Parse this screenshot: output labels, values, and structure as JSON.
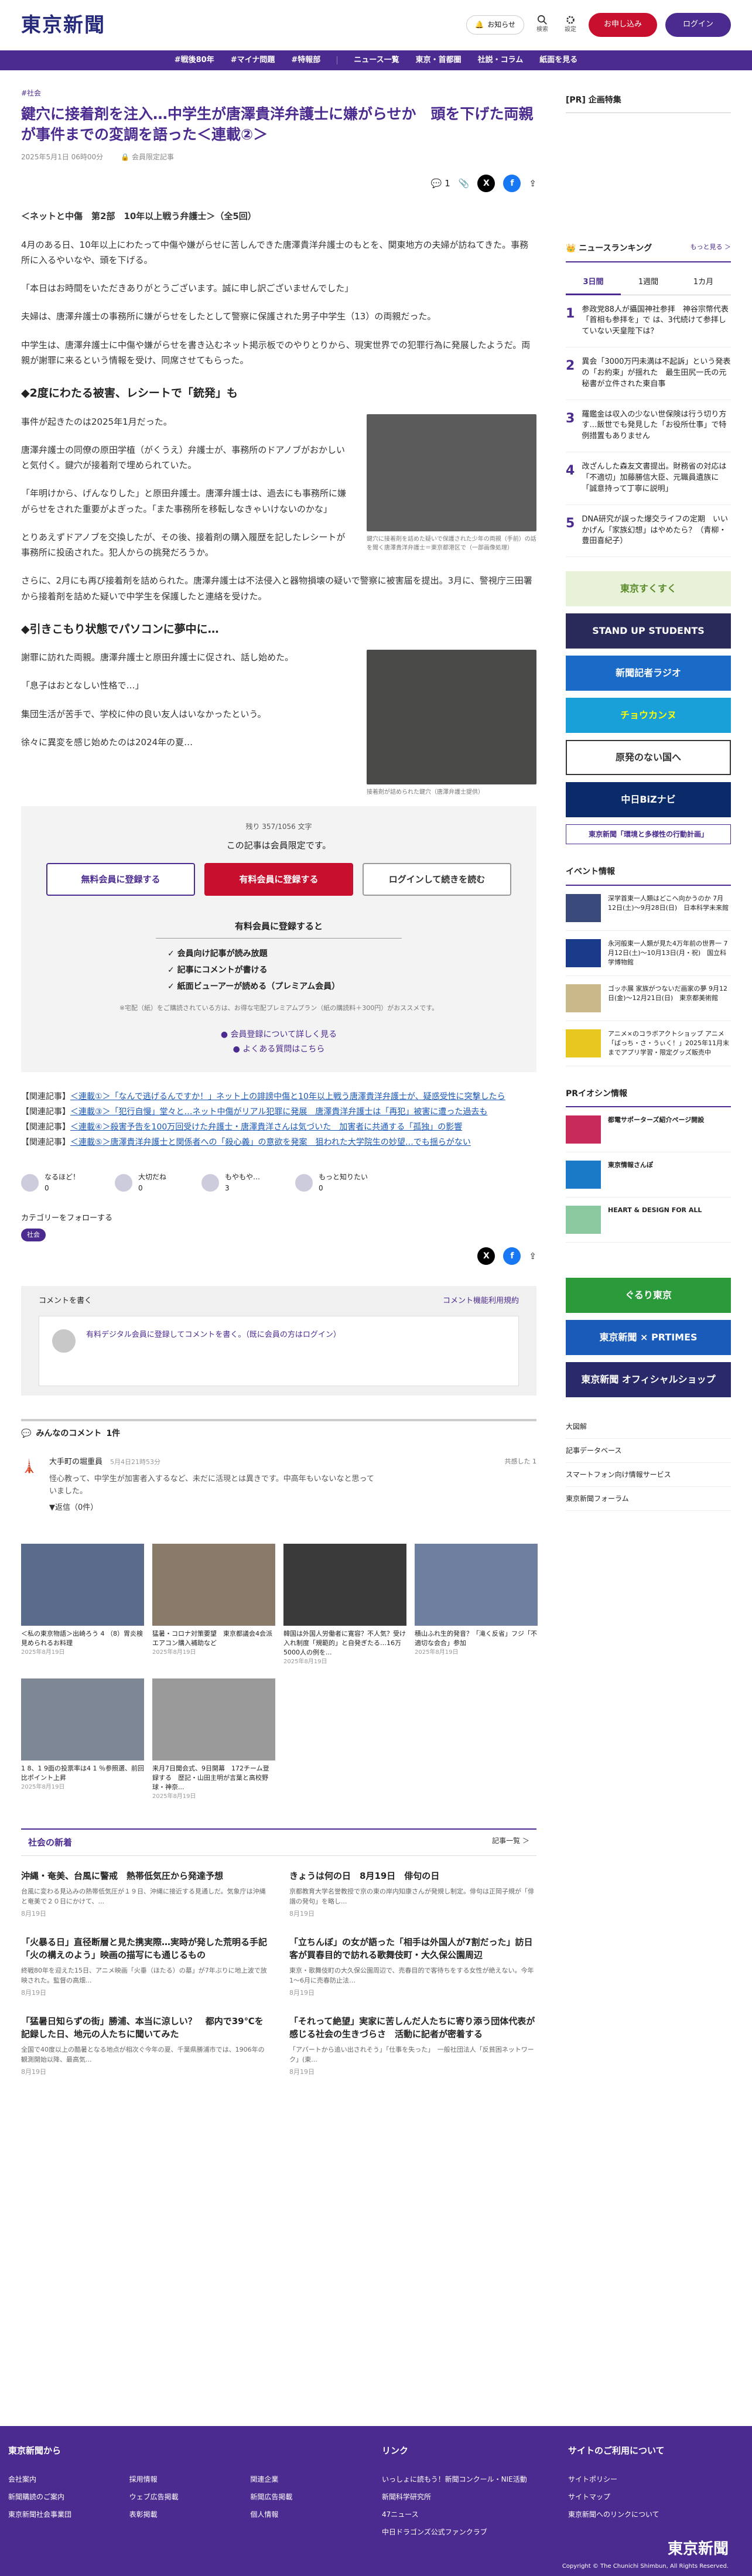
{
  "header": {
    "logo": "東京新聞",
    "notice": "お知らせ",
    "search": "検索",
    "settings": "設定",
    "register": "お申し込み",
    "login": "ログイン"
  },
  "nav": [
    "#戦後80年",
    "#マイナ問題",
    "#特報部",
    "ニュース一覧",
    "東京・首都圏",
    "社説・コラム",
    "紙面を見る"
  ],
  "article": {
    "category": "#社会",
    "title": "鍵穴に接着剤を注入…中学生が唐澤貴洋弁護士に嫌がらせか　頭を下げた両親が事件までの変調を語った＜連載②＞",
    "date": "2025年5月1日 06時00分",
    "member": "会員限定記事",
    "comment_count": "1",
    "subhead": "＜ネットと中傷　第2部　10年以上戦う弁護士＞（全5回）",
    "p1": "4月のある日、10年以上にわたって中傷や嫌がらせに苦しんできた唐澤貴洋弁護士のもとを、関東地方の夫婦が訪ねてきた。事務所に入るやいなや、頭を下げる。",
    "p2": "「本日はお時間をいただきありがとうございます。誠に申し訳ございませんでした」",
    "p3": "夫婦は、唐澤弁護士の事務所に嫌がらせをしたとして警察に保護された男子中学生（13）の両親だった。",
    "p4": "中学生は、唐澤弁護士に中傷や嫌がらせを書き込むネット掲示板でのやりとりから、現実世界での犯罪行為に発展したようだ。両親が謝罪に来るという情報を受け、同席させてもらった。",
    "h2a": "◆2度にわたる被害、レシートで「銃発」も",
    "p5": "事件が起きたのは2025年1月だった。",
    "p6": "唐澤弁護士の同僚の原田学植（がくうえ）弁護士が、事務所のドアノブがおかしいと気付く。鍵穴が接着剤で埋められていた。",
    "p7": "「年明けから、げんなりした」と原田弁護士。唐澤弁護士は、過去にも事務所に嫌がらせをされた重要がよぎった。「また事務所を移転しなきゃいけないのかな」",
    "p8": "とりあえずドアノブを交換したが、その後、接着剤の購入履歴を記したレシートが事務所に投函された。犯人からの挑発だろうか。",
    "p9": "さらに、2月にも再び接着剤を詰められた。唐澤弁護士は不法侵入と器物損壊の疑いで警察に被害届を提出。3月に、警視庁三田署から接着剤を詰めた疑いで中学生を保護したと連絡を受けた。",
    "h2b": "◆引きこもり状態でパソコンに夢中に…",
    "p10": "謝罪に訪れた両親。唐澤弁護士と原田弁護士に促され、話し始めた。",
    "p11": "「息子はおとなしい性格で…」",
    "p12": "集団生活が苦手で、学校に仲の良い友人はいなかったという。",
    "p13": "徐々に異変を感じ始めたのは2024年の夏…",
    "cap1": "鍵穴に接着剤を詰めた疑いで保護された少年の両親（手前）の話を聞く唐澤貴洋弁護士＝東京都港区で（一部画像処理）",
    "cap2": "接着剤が詰められた鍵穴（唐澤弁護士提供）"
  },
  "paywall": {
    "remaining": "残り 357/1056 文字",
    "message": "この記事は会員限定です。",
    "free_btn": "無料会員に登録する",
    "paid_btn": "有料会員に登録する",
    "login_btn": "ログインして続きを読む",
    "perk_head": "有料会員に登録すると",
    "perks": [
      "✓ 会員向け記事が読み放題",
      "✓ 記事にコメントが書ける",
      "✓ 紙面ビューアーが読める（プレミアム会員）"
    ],
    "note": "※宅配（紙）をご購読されている方は、お得な宅配プレミアムプラン（紙の購読料＋300円）がおススメです。",
    "link1": "● 会員登録について詳しく見る",
    "link2": "● よくある質問はこちら"
  },
  "related": [
    {
      "label": "【関連記事】",
      "text": "＜連載①＞「なんで逃げるんですか！」ネット上の誹謗中傷と10年以上戦う唐澤貴洋弁護士が、疑惑受性に突撃したら"
    },
    {
      "label": "【関連記事】",
      "text": "＜連載③＞「犯行自慢」堂々と…ネット中傷がリアル犯罪に発展　唐澤貴洋弁護士は「再犯」被害に遭った過去も"
    },
    {
      "label": "【関連記事】",
      "text": "＜連載④＞殺害予告を100万回受けた弁護士・唐澤貴洋さんは気づいた　加害者に共通する「孤独」の影響"
    },
    {
      "label": "【関連記事】",
      "text": "＜連載⑤＞唐澤貴洋弁護士と関係者への「殺心義」の意欲を発案　狙われた大学院生の妙望…でも揺らがない"
    }
  ],
  "reactions": [
    {
      "label": "なるほど！",
      "count": "0"
    },
    {
      "label": "大切だね",
      "count": "0"
    },
    {
      "label": "もやもや…",
      "count": "3"
    },
    {
      "label": "もっと知りたい",
      "count": "0"
    }
  ],
  "follow": {
    "title": "カテゴリーをフォローする",
    "tag": "社会"
  },
  "comment_box": {
    "title": "コメントを書く",
    "rule": "コメント機能利用規約",
    "prompt": "有料デジタル会員に登録してコメントを書く。（既に会員の方はログイン）"
  },
  "comments": {
    "title": "みんなのコメント",
    "count": "1件",
    "user": "大手町の堀重員",
    "time": "5月4日21時53分",
    "body": "怪心教って、中学生が加害者入するなど、未だに活現とは異きです。中高年もいないなと思っていました。",
    "reply": "▼返信（0件）",
    "likes": "共感した 1"
  },
  "cards": [
    {
      "t": "＜私の東京物語＞出崎ろう 4 （8）胃炎検見められるお料理",
      "d": "2025年8月19日"
    },
    {
      "t": "猛暑・コロナ対策要望　東京都議会4会派　エアコン購入補助など",
      "d": "2025年8月19日"
    },
    {
      "t": "韓国は外国人労働者に寛容？不人気？受け入れ制度「規範的」と自発ぎたる…16万5000人の例を...",
      "d": "2025年8月19日"
    },
    {
      "t": "積山ふれ生的発音？「滝く反省」フジ「不適切な会合」参加",
      "d": "2025年8月19日"
    },
    {
      "t": "1 8、1 9面の投票率は4 1 ％参照選、前回比ポイント上昇",
      "d": "2025年8月19日"
    },
    {
      "t": "来月7日聞会式、9日開幕　172チーム登録する　歴記・山田主明が言葉と高校野球・神奈...",
      "d": "2025年8月19日"
    }
  ],
  "section": {
    "title": "社会の新着",
    "more": "記事一覧 ＞",
    "items": [
      {
        "t": "沖縄・奄美、台風に警戒　熱帯低気圧から発達予想",
        "b": "台風に変わる見込みの熱帯低気圧が１９日、沖縄に接近する見通しだ。気象庁は沖縄と奄美で２０日にかけて、...",
        "d": "8月19日"
      },
      {
        "t": "きょうは何の日　8月19日　俳句の日",
        "b": "京都教育大学名誉教授で京の東の岸内知康さんが発規し制定。俳句は正岡子規が「俳諧の発句」を略し...",
        "d": "8月19日"
      },
      {
        "t": "「火暴る日」直径断層と見た携実際…実時が発した荒明る手記「火の構えのよう」映画の描写にも通じるもの",
        "b": "終戦80年を迎えた15日、アニメ映画「火垂（ほたる）の墓」が7年ぶりに地上波で放映された。監督の高畑...",
        "d": "8月19日"
      },
      {
        "t": "「立ちんぼ」の女が語った「相手は外国人が7割だった」訪日客が買春目的で訪れる歌舞伎町・大久保公園周辺",
        "b": "東京・歌舞伎町の大久保公園周辺で、売春目的で客待ちをする女性が絶えない。今年1〜6月に売春防止法…",
        "d": "8月19日"
      },
      {
        "t": "「猛暑日知らずの街」勝浦、本当に涼しい？　都内で39℃を記録した日、地元の人たちに聞いてみた",
        "b": "全国で40度以上の酷暑となる地点が相次ぐ今年の夏、千葉県勝浦市では、1906年の観測開始以降、最高気...",
        "d": "8月19日"
      },
      {
        "t": "「それって絶望」実家に苦しんだ人たちに寄り添う団体代表が感じる社会の生きづらさ　活動に記者が密着する",
        "b": "「アパートから追い出されそう」「仕事を失った」　一般社団法人「反貧困ネットワーク」(東...",
        "d": "8月19日"
      }
    ]
  },
  "sidebar": {
    "pr": "[PR] 企画特集",
    "ranking_title": "ニュースランキング",
    "ranking_more": "もっと見る ＞",
    "tabs": [
      "3日間",
      "1週間",
      "1カ月"
    ],
    "ranks": [
      {
        "n": "1",
        "t": "参政党88人が攝国神社参拝　神谷宗幣代表「首相も参拝を」で は、3代続けて参拝していない天皇陛下は？"
      },
      {
        "n": "2",
        "t": "異会「3000万円未満は不起訴」という発表の「お約束」が揺れた　最生田尻一氏の元秘書が立件された東自事"
      },
      {
        "n": "3",
        "t": "羅鑑金は収入の少ない世保険は行う切り方す…飯世でも発見した「お役所仕事」で特例措置もありません"
      },
      {
        "n": "4",
        "t": "改ざんした森友文書提出。財務省の対応は「不適切」加藤勝信大臣、元職員遺族に「誠意持って丁寧に説明」"
      },
      {
        "n": "5",
        "t": "DNA研究が誤った爆交ライフの定期　いいかげん「家族幻想」はやめたら？（青柳・豊田喜紀子）"
      }
    ],
    "banners": [
      "東京すくすく",
      "STAND UP STUDENTS",
      "新聞記者ラジオ",
      "チョウカンヌ",
      "原発のない国へ",
      "中日BiZナビ",
      "東京新聞「環境と多様性の行動計画」"
    ],
    "events_title": "イベント情報",
    "events": [
      "深学首東一人類はどこへ向かうのか 7月12日(土)〜9月28日(日)　日本科学未来館",
      "永河般東一人類が見た4万年前の世界一 7月12日(土)〜10月13日(月・祝)　国立科学博物館",
      "ゴッホ展 家族がつないだ画家の夢 9月12日(金)〜12月21日(日)　東京都美術館",
      "アニメ×のコラボアクトショップ アニメ「ばっち・さ・うぃく！」2025年11月末までアプリ学習・限定グッズ販売中"
    ],
    "pr_title": "PRイオシン情報",
    "prs": [
      "都電サポーターズ紹介ページ開設",
      "東京情報さんぽ",
      "HEART & DESIGN FOR ALL"
    ],
    "links": [
      "大図解",
      "記事データベース",
      "スマートフォン向け情報サービス",
      "東京新聞フォーラム"
    ]
  },
  "footer": {
    "col1": "東京新聞から",
    "col1_items": [
      "会社案内",
      "新聞購読のご案内",
      "東京新聞社会事業団",
      "採用情報",
      "ウェブ広告掲載",
      "表彰掲載",
      "関連企業",
      "新聞広告掲載",
      "個人情報"
    ],
    "col2": "リンク",
    "col2_items": [
      "いっしょに読もう！新聞コンクール・NIE活動",
      "新聞科学研究所",
      "47ニュース",
      "中日ドラゴンズ公式ファンクラブ"
    ],
    "col3": "サイトのご利用について",
    "col3_items": [
      "サイトポリシー",
      "サイトマップ",
      "東京新聞へのリンクについて"
    ],
    "copyright": "Copyright © The Chunichi Shimbun, All Rights Reserved."
  }
}
